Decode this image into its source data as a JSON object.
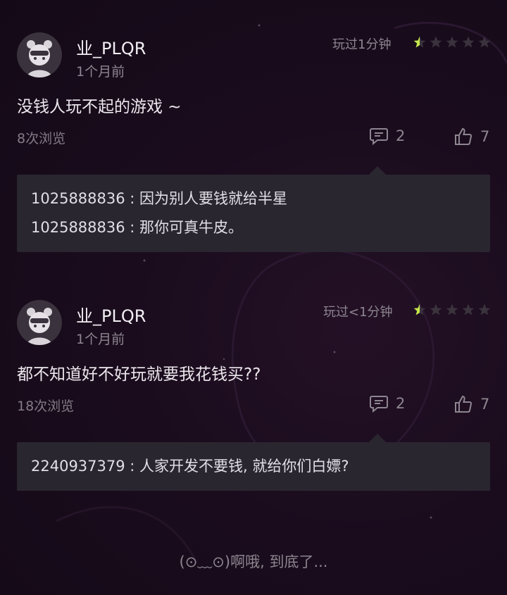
{
  "reviews": [
    {
      "username": "业_PLQR",
      "time": "1个月前",
      "played": "玩过1分钟",
      "rating": 0.5,
      "content": "没钱人玩不起的游戏 ~",
      "views": "8次浏览",
      "comment_count": "2",
      "like_count": "7",
      "replies": [
        {
          "text": "1025888836 : 因为别人要钱就给半星"
        },
        {
          "text": "1025888836 : 那你可真牛皮。"
        }
      ]
    },
    {
      "username": "业_PLQR",
      "time": "1个月前",
      "played": "玩过<1分钟",
      "rating": 0.5,
      "content": "都不知道好不好玩就要我花钱买??",
      "views": "18次浏览",
      "comment_count": "2",
      "like_count": "7",
      "replies": [
        {
          "text": "2240937379 : 人家开发不要钱, 就给你们白嫖?"
        }
      ]
    }
  ],
  "footer": {
    "end_text": "(⊙﹏⊙)啊哦, 到底了..."
  },
  "colors": {
    "accent": "#c6e84a",
    "star_empty": "#3a333d",
    "bg": "#1a0c1d"
  }
}
